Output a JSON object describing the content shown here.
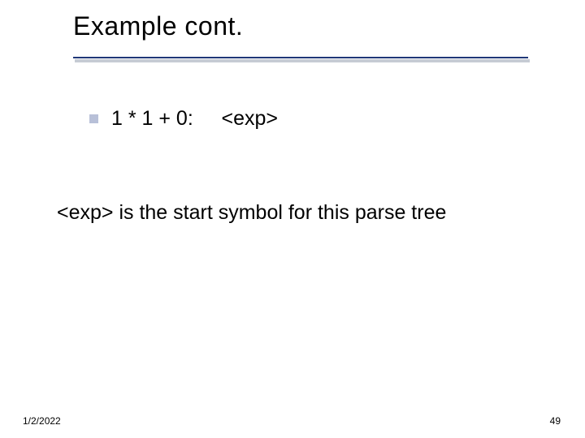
{
  "title": "Example cont.",
  "bullet": {
    "expression": "1 * 1 + 0:",
    "result": "<exp>"
  },
  "body": "<exp> is the start symbol for this parse tree",
  "footer": {
    "date": "1/2/2022",
    "page": "49"
  }
}
